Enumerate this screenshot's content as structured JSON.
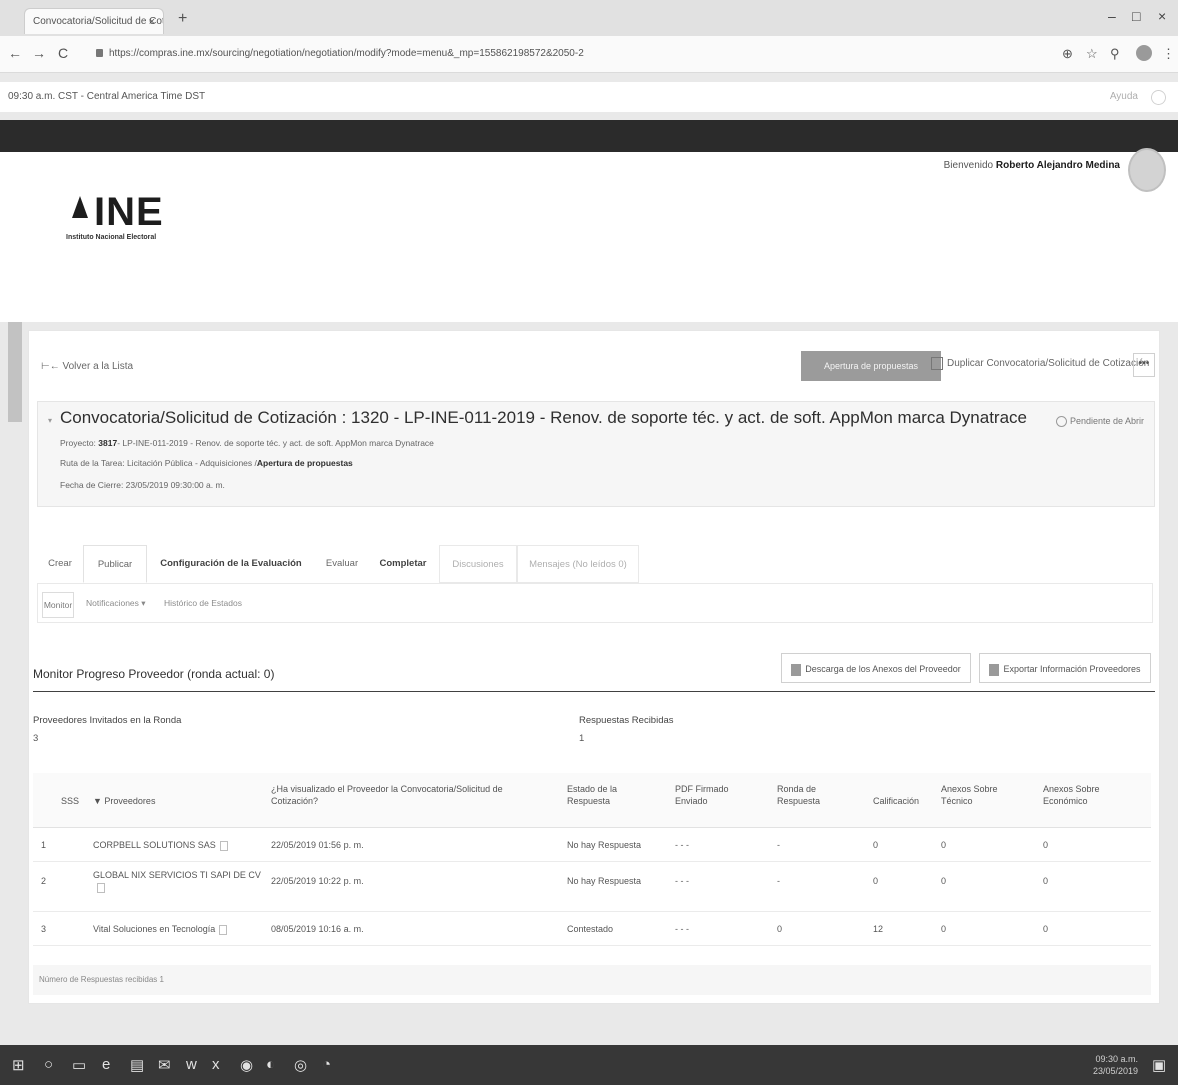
{
  "browser": {
    "tab_title": "Convocatoria/Solicitud de Cotiz",
    "tab_close": "×",
    "new_tab": "+",
    "url": "https://compras.ine.mx/sourcing/negotiation/negotiation/modify?mode=menu&_mp=155862198572&2050-2",
    "min": "–",
    "max": "□",
    "close": "×",
    "back": "←",
    "forward": "→",
    "reload": "C"
  },
  "app": {
    "time_text": "09:30 a.m. CST - Central America Time DST",
    "help_label": "Ayuda",
    "welcome_prefix": "Bienvenido",
    "user_name": "Roberto Alejandro Medina",
    "logo_name": "INE",
    "logo_sub": "Instituto Nacional Electoral"
  },
  "toolbar": {
    "back_label": "Volver a la Lista",
    "primary_label": "Apertura de propuestas",
    "duplicate_label": "Duplicar Convocatoria/Solicitud de Cotización",
    "more_label": "•••"
  },
  "negotiation": {
    "title": "Convocatoria/Solicitud de Cotización : 1320 - LP-INE-011-2019 - Renov. de soporte téc. y act. de soft. AppMon marca Dynatrace",
    "status": "Pendiente de Abrir",
    "project_label": "Proyecto",
    "project_id": "3817",
    "project_text": "- LP-INE-011-2019 - Renov. de soporte téc. y act. de soft. AppMon marca Dynatrace",
    "route_label": "Ruta de la Tarea",
    "route_text": "Licitación Pública - Adquisiciones /",
    "route_step": "Apertura de propuestas",
    "close_date": "Fecha de Cierre: 23/05/2019 09:30:00 a. m."
  },
  "tabs": [
    {
      "label": "Crear"
    },
    {
      "label": "Publicar"
    },
    {
      "label": "Configuración de la Evaluación"
    },
    {
      "label": "Evaluar"
    },
    {
      "label": "Completar"
    },
    {
      "label": "Discusiones"
    },
    {
      "label": "Mensajes (No leídos 0)"
    }
  ],
  "subtabs": {
    "monitor": "Monitor",
    "notifications": "Notificaciones ▾",
    "history": "Histórico de Estados"
  },
  "monitor": {
    "title": "Monitor Progreso Proveedor (ronda actual: 0)",
    "download_btn": "Descarga de los Anexos del Proveedor",
    "export_btn": "Exportar Información Proveedores",
    "invited_label": "Proveedores Invitados en la Ronda",
    "invited_value": "3",
    "received_label": "Respuestas Recibidas",
    "received_value": "1"
  },
  "table": {
    "headers": {
      "sss": "SSS",
      "provider": "▼ Proveedores",
      "viewed": "¿Ha visualizado el Proveedor la Convocatoria/Solicitud de Cotización?",
      "status": "Estado de la Respuesta",
      "pdf": "PDF Firmado Enviado",
      "round": "Ronda de Respuesta",
      "score": "Calificación",
      "tech": "Anexos Sobre Técnico",
      "econ": "Anexos Sobre Económico"
    },
    "rows": [
      {
        "n": "1",
        "provider": "CORPBELL SOLUTIONS SAS",
        "provider2": "",
        "viewed": "22/05/2019 01:56 p. m.",
        "status": "No hay Respuesta",
        "pdf": "- - -",
        "round": "-",
        "score": "0",
        "tech": "0",
        "econ": "0"
      },
      {
        "n": "2",
        "provider": "GLOBAL NIX SERVICIOS TI SAPI DE CV",
        "provider2": "",
        "viewed": "22/05/2019 10:22 p. m.",
        "status": "No hay Respuesta",
        "pdf": "- - -",
        "round": "-",
        "score": "0",
        "tech": "0",
        "econ": "0"
      },
      {
        "n": "3",
        "provider": "Vital Soluciones en Tecnología",
        "provider2": "",
        "viewed": "08/05/2019 10:16 a. m.",
        "status": "Contestado",
        "pdf": "- - -",
        "round": "0",
        "score": "12",
        "tech": "0",
        "econ": "0"
      }
    ],
    "footer": "Número de Respuestas recibidas 1"
  },
  "taskbar": {
    "time": "09:30 a.m.",
    "date": "23/05/2019"
  }
}
